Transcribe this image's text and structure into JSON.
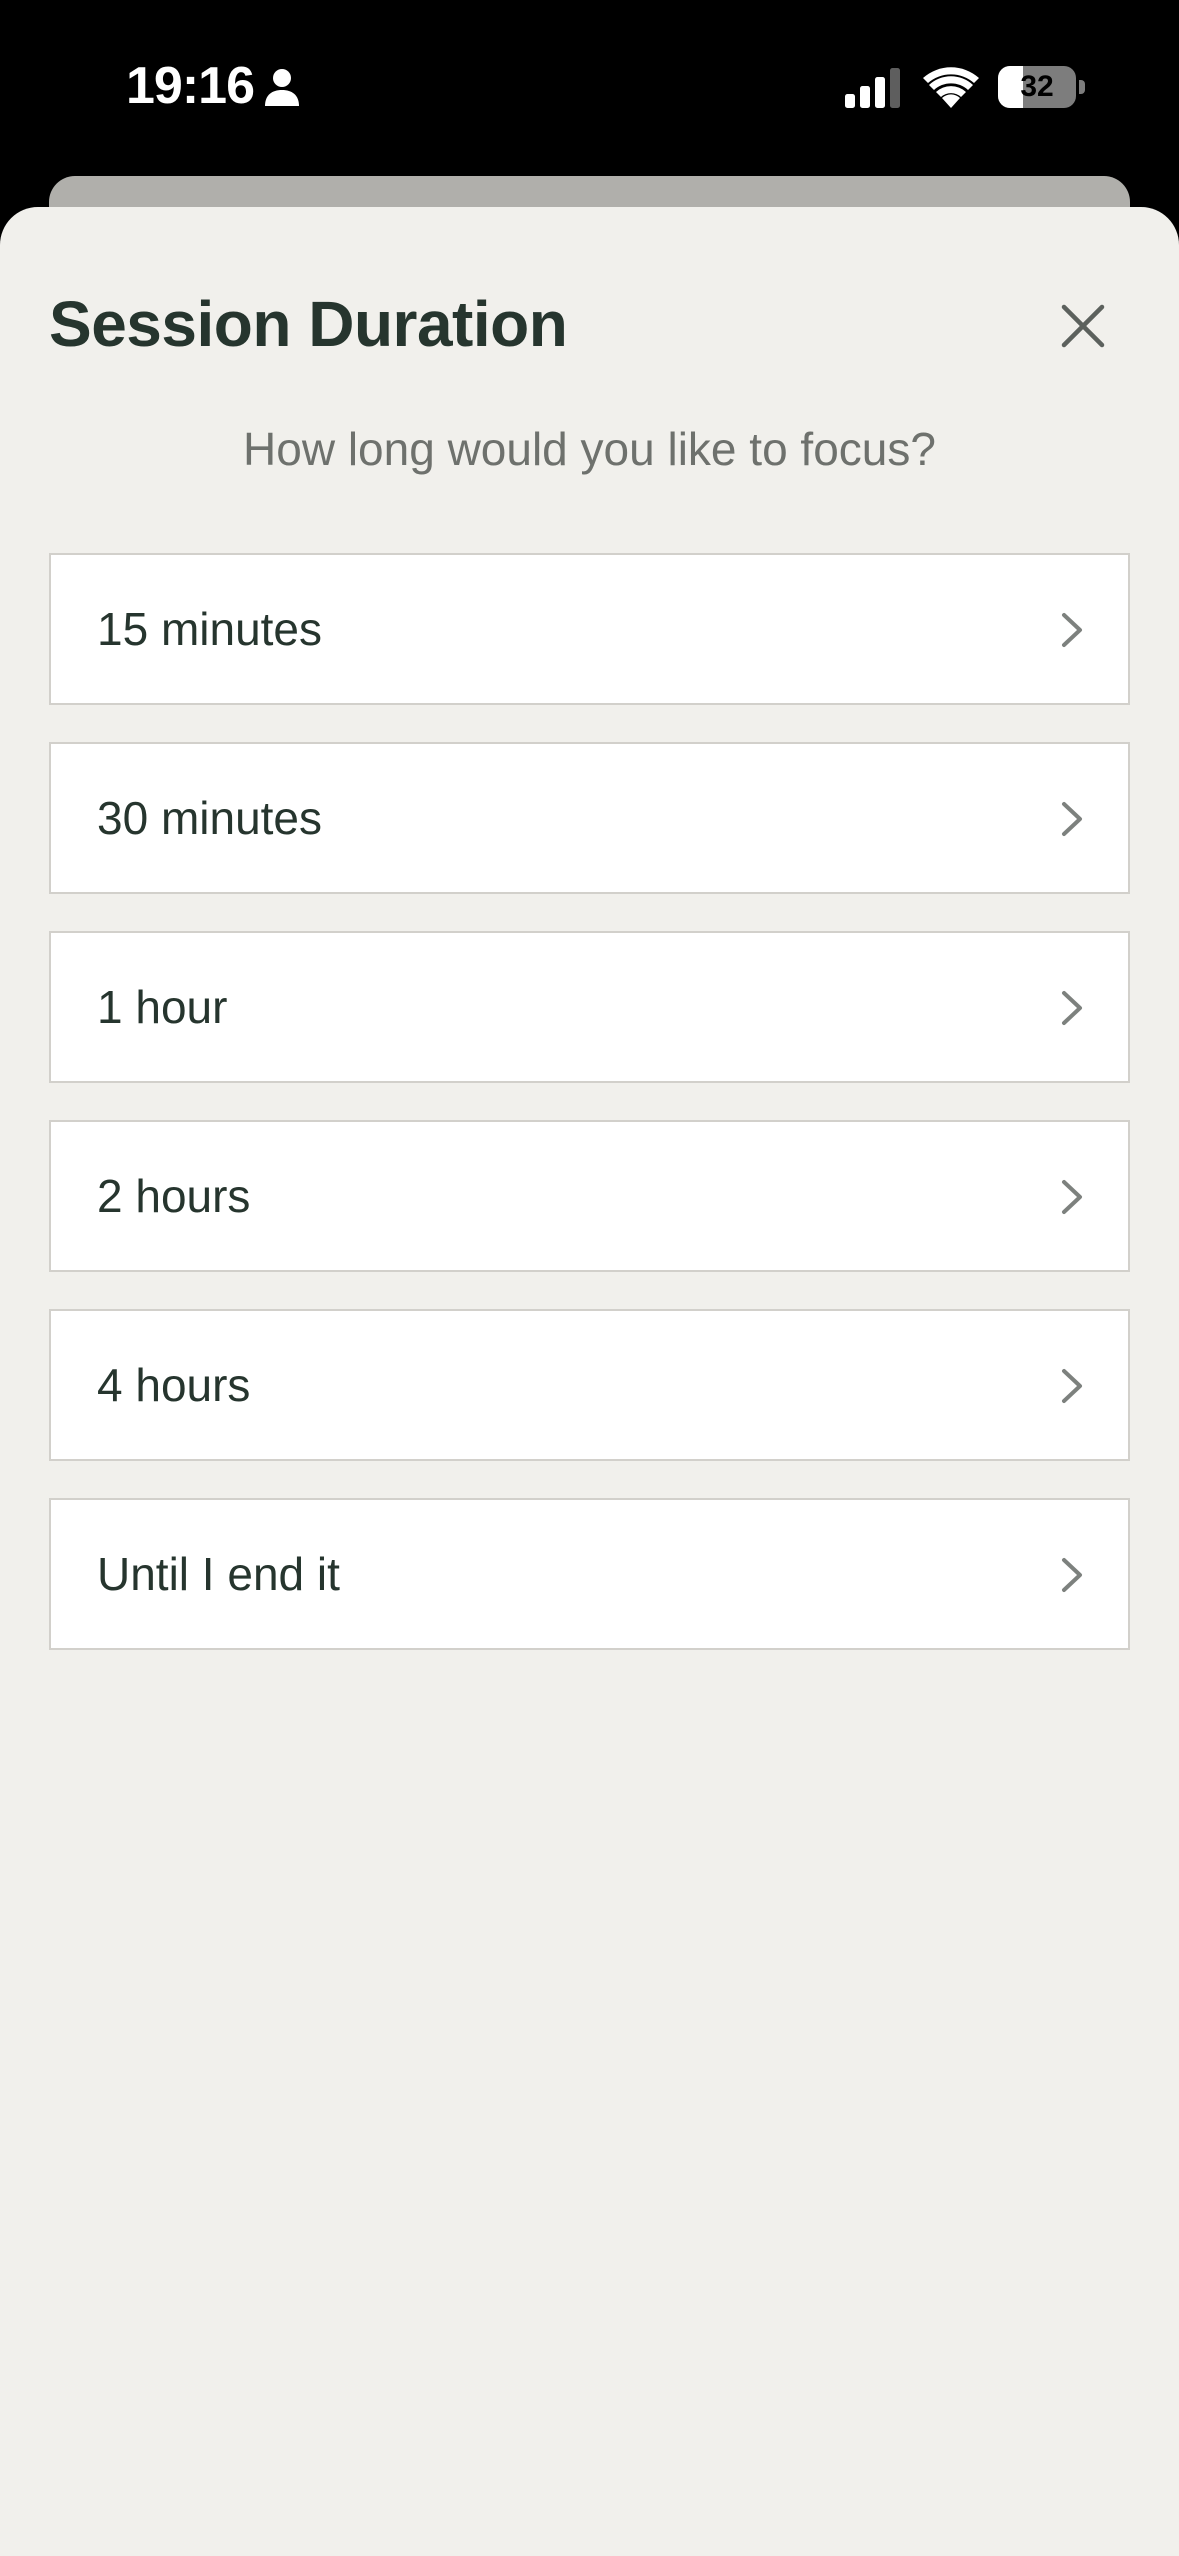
{
  "status_bar": {
    "time": "19:16",
    "battery_level": "32",
    "battery_fraction": 0.32,
    "icons": [
      "person-icon",
      "signal-icon",
      "wifi-icon",
      "battery-icon"
    ]
  },
  "sheet": {
    "title": "Session Duration",
    "close_icon": "close-icon",
    "subtitle": "How long would you like to focus?"
  },
  "options": [
    {
      "label": "15 minutes",
      "icon": "chevron-right-icon"
    },
    {
      "label": "30 minutes",
      "icon": "chevron-right-icon"
    },
    {
      "label": "1 hour",
      "icon": "chevron-right-icon"
    },
    {
      "label": "2 hours",
      "icon": "chevron-right-icon"
    },
    {
      "label": "4 hours",
      "icon": "chevron-right-icon"
    },
    {
      "label": "Until I end it",
      "icon": "chevron-right-icon"
    }
  ],
  "colors": {
    "sheet_background": "#f1f0ec",
    "text_primary": "#26352e",
    "text_secondary": "#6e716d",
    "option_border": "#d2d0cb",
    "chevron": "#7d817e"
  }
}
